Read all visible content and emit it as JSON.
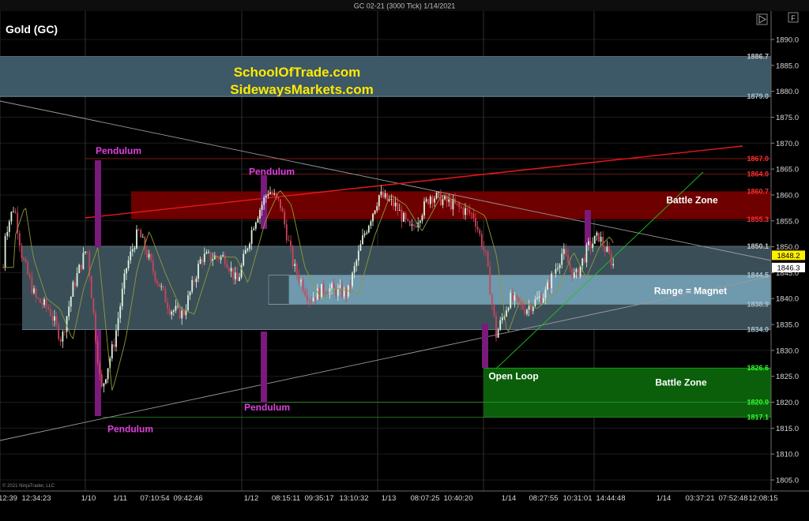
{
  "window": {
    "title": "GC 02-21 (3000 Tick)  1/14/2021",
    "instrument": "Gold (GC)",
    "copyright": "© 2021 NinjaTrader, LLC"
  },
  "promo": {
    "line1": "SchoolOfTrade.com",
    "line2": "SidewaysMarkets.com",
    "color": "#ffea00"
  },
  "colors": {
    "background": "#000000",
    "grid": "#2a2a2a",
    "price_text": "#d8d8d8",
    "annotation_magenta": "#e040e0",
    "resistance_red": "#e81818",
    "support_green": "#20e020"
  },
  "chart_data": {
    "type": "candlestick",
    "ylim": [
      1802,
      1894
    ],
    "y_ticks": [
      1805,
      1810,
      1815,
      1820,
      1825,
      1830,
      1835,
      1840,
      1845,
      1850,
      1855,
      1860,
      1865,
      1870,
      1875,
      1880,
      1885,
      1890
    ],
    "x_labels": [
      "12:39",
      "12:34:23",
      "1/10",
      "1/11",
      "07:10:54",
      "09:42:46",
      "1/12",
      "08:15:11",
      "09:35:17",
      "13:10:32",
      "1/13",
      "08:07:25",
      "10:40:20",
      "1/14",
      "08:27:55",
      "10:31:01",
      "14:44:48",
      "1/14",
      "03:37:21",
      "07:52:48",
      "12:08:15"
    ],
    "zones": [
      {
        "name": "top-zone",
        "from": 1879.0,
        "to": 1886.7,
        "color": "#3d5866"
      },
      {
        "name": "range-outer",
        "from": 1834.0,
        "to": 1850.1,
        "color": "#3a4e58"
      },
      {
        "name": "range-inner",
        "from": 1838.9,
        "to": 1844.5,
        "color": "#6f99ad"
      },
      {
        "name": "red-battle-zone",
        "from": 1855.3,
        "to": 1860.7,
        "color": "#6e0000"
      },
      {
        "name": "green-battle-zone",
        "from": 1817.1,
        "to": 1826.6,
        "color": "#0b5f0b"
      }
    ],
    "level_labels": [
      {
        "value": 1886.7,
        "label": "1886.7",
        "color": "#c8c8c8"
      },
      {
        "value": 1879.0,
        "label": "1879.0",
        "color": "#a8c4d2"
      },
      {
        "value": 1867.0,
        "label": "1867.0",
        "color": "#ff3030"
      },
      {
        "value": 1864.0,
        "label": "1864.0",
        "color": "#ff3030"
      },
      {
        "value": 1860.7,
        "label": "1860.7",
        "color": "#ff3030"
      },
      {
        "value": 1855.3,
        "label": "1855.3",
        "color": "#ff3030"
      },
      {
        "value": 1850.1,
        "label": "1850.1",
        "color": "#c8c8c8"
      },
      {
        "value": 1844.5,
        "label": "1844.5",
        "color": "#a8c4d2"
      },
      {
        "value": 1838.9,
        "label": "1838.9",
        "color": "#a8c4d2"
      },
      {
        "value": 1834.0,
        "label": "1834.0",
        "color": "#a8c4d2"
      },
      {
        "value": 1826.6,
        "label": "1826.6",
        "color": "#30ff30"
      },
      {
        "value": 1820.0,
        "label": "1820.0",
        "color": "#30ff30"
      },
      {
        "value": 1817.1,
        "label": "1817.1",
        "color": "#30ff30"
      }
    ],
    "price_markers": [
      {
        "value": 1848.2,
        "label": "1848.2",
        "bg": "#ffee00",
        "fg": "#000000"
      },
      {
        "value": 1846.3,
        "label": "1846.3",
        "bg": "#ffffff",
        "fg": "#000000"
      }
    ],
    "annotations": [
      {
        "text": "Pendulum",
        "price": 1868.5,
        "color": "#e040e0"
      },
      {
        "text": "Pendulum",
        "price": 1864.5,
        "color": "#e040e0"
      },
      {
        "text": "Pendulum",
        "price": 1819.0,
        "color": "#e040e0"
      },
      {
        "text": "Pendulum",
        "price": 1814.8,
        "color": "#e040e0"
      },
      {
        "text": "Battle Zone",
        "price": 1859.0,
        "color": "#ffffff"
      },
      {
        "text": "Range = Magnet",
        "price": 1841.5,
        "color": "#ffffff"
      },
      {
        "text": "Open Loop",
        "price": 1825.0,
        "color": "#ffffff"
      },
      {
        "text": "Battle Zone",
        "price": 1823.8,
        "color": "#ffffff"
      }
    ]
  }
}
